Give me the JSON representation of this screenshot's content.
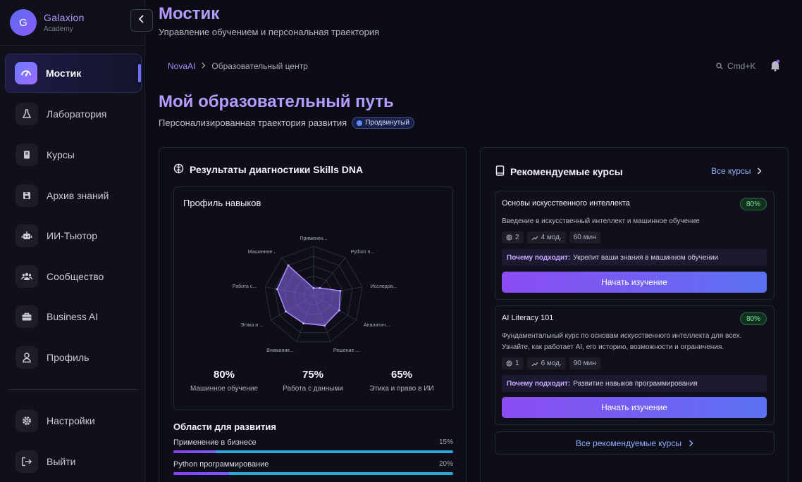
{
  "brand": {
    "initial": "G",
    "name": "Galaxion",
    "sub": "Academy"
  },
  "sidebar": {
    "items": [
      {
        "label": "Мостик",
        "icon": "gauge-icon"
      },
      {
        "label": "Лаборатория",
        "icon": "flask-icon"
      },
      {
        "label": "Курсы",
        "icon": "book-icon"
      },
      {
        "label": "Архив знаний",
        "icon": "save-icon"
      },
      {
        "label": "ИИ-Тьютор",
        "icon": "robot-icon"
      },
      {
        "label": "Сообщество",
        "icon": "users-icon"
      },
      {
        "label": "Business AI",
        "icon": "briefcase-icon"
      },
      {
        "label": "Профиль",
        "icon": "user-icon"
      }
    ],
    "bottom": [
      {
        "label": "Настройки",
        "icon": "gear-icon"
      },
      {
        "label": "Выйти",
        "icon": "logout-icon"
      }
    ]
  },
  "header": {
    "title": "Мостик",
    "subtitle": "Управление обучением и персональная траектория",
    "breadcrumb": [
      "NovaAI",
      "Образовательный центр"
    ],
    "search_hint": "Cmd+K"
  },
  "main": {
    "heading": "Мой образовательный путь",
    "subheading": "Персонализированная траектория развития",
    "level_badge": "Продвинутый"
  },
  "diagnostics": {
    "title": "Результаты диагностики Skills DNA",
    "profile_title": "Профиль навыков",
    "radar_labels": [
      "Применен...",
      "Python п...",
      "Исследов...",
      "Аналитич...",
      "Решение ...",
      "Внимание...",
      "Этика и ...",
      "Работа с...",
      "Машинное..."
    ],
    "radar_values": [
      0.15,
      0.2,
      0.55,
      0.6,
      0.65,
      0.6,
      0.65,
      0.75,
      0.8
    ],
    "stats": [
      {
        "value": "80%",
        "label": "Машинное обучение"
      },
      {
        "value": "75%",
        "label": "Работа с данными"
      },
      {
        "value": "65%",
        "label": "Этика и право в ИИ"
      }
    ],
    "areas_title": "Области для развития",
    "areas": [
      {
        "label": "Применение в бизнесе",
        "pct": "15%",
        "fill": 0.15
      },
      {
        "label": "Python программирование",
        "pct": "20%",
        "fill": 0.2
      }
    ]
  },
  "recommended": {
    "title": "Рекомендуемые курсы",
    "all_link": "Все курсы",
    "courses": [
      {
        "title": "Основы искусственного интеллекта",
        "match": "80%",
        "desc": "Введение в искусственный интеллект и машинное обучение",
        "level": "2",
        "modules": "4 мод.",
        "duration": "60 мин",
        "why_label": "Почему подходит:",
        "why_text": "Укрепит ваши знания в машинном обучении",
        "cta": "Начать изучение"
      },
      {
        "title": "AI Literacy 101",
        "match": "80%",
        "desc": "Фундаментальный курс по основам искусственного интеллекта для всех. Узнайте, как работает AI, его историю, возможности и ограничения.",
        "level": "1",
        "modules": "6 мод.",
        "duration": "90 мин",
        "why_label": "Почему подходит:",
        "why_text": "Развитие навыков программирования",
        "cta": "Начать изучение"
      }
    ],
    "all_recommended": "Все рекомендуемые курсы"
  },
  "colors": {
    "accent": "#b49bff",
    "button_start": "#8b4cf2",
    "button_end": "#5b72f2",
    "success": "#7be59a",
    "link": "#8fb0ff"
  }
}
